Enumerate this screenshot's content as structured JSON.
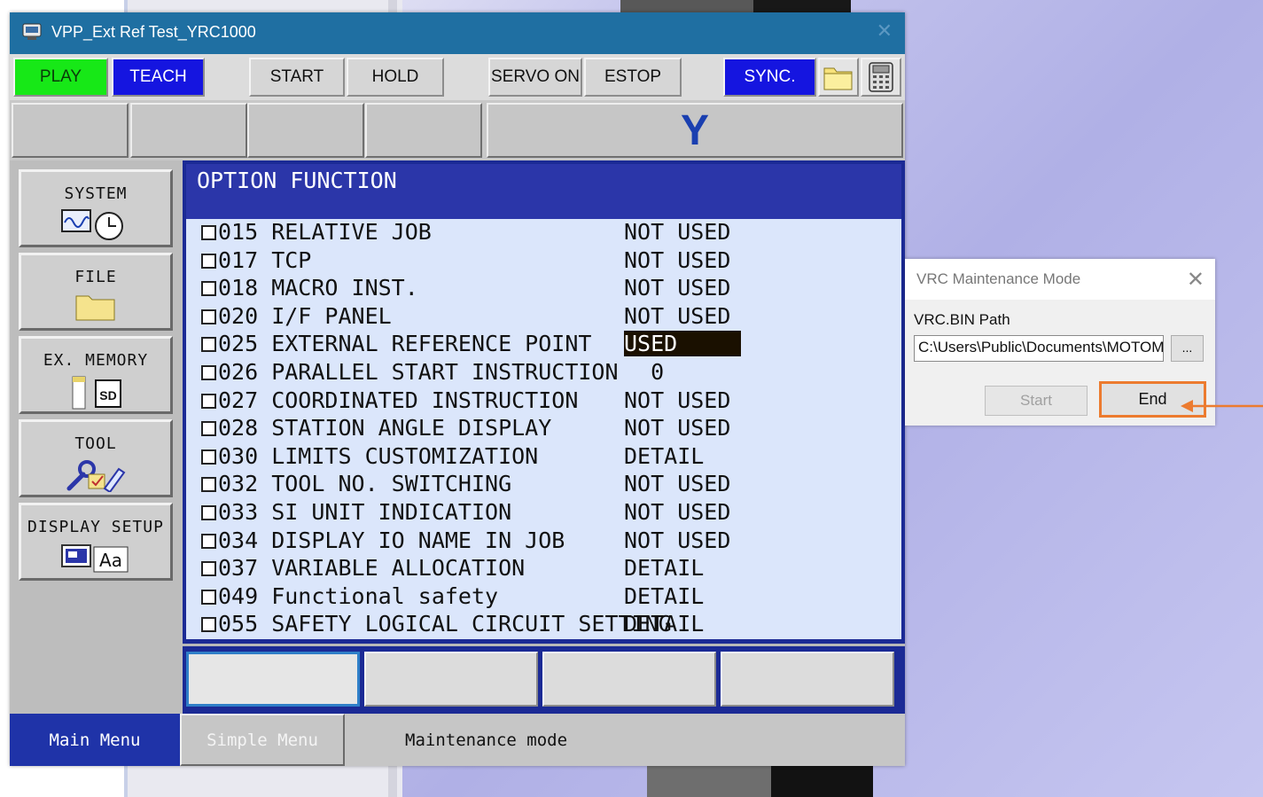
{
  "window": {
    "title": "VPP_Ext Ref Test_YRC1000",
    "close_glyph": "✕"
  },
  "toolbar": {
    "play": "PLAY",
    "teach": "TEACH",
    "start": "START",
    "hold": "HOLD",
    "servo_on": "SERVO ON",
    "estop": "ESTOP",
    "sync": "SYNC.",
    "folder_icon": "folder-icon",
    "pendant_icon": "teach-pendant-icon"
  },
  "logo": "Y",
  "sidebar": {
    "items": [
      {
        "label": "SYSTEM",
        "icon": "system-icon"
      },
      {
        "label": "FILE",
        "icon": "folder-icon"
      },
      {
        "label": "EX. MEMORY",
        "icon": "sd-card-icon"
      },
      {
        "label": "TOOL",
        "icon": "tool-icon"
      },
      {
        "label": "DISPLAY SETUP",
        "icon": "display-setup-icon"
      }
    ]
  },
  "panel": {
    "title": "OPTION FUNCTION",
    "rows": [
      {
        "name": "015 RELATIVE JOB",
        "value": "NOT USED"
      },
      {
        "name": "017 TCP",
        "value": "NOT USED"
      },
      {
        "name": "018 MACRO INST.",
        "value": "NOT USED"
      },
      {
        "name": "020 I/F PANEL",
        "value": "NOT USED"
      },
      {
        "name": "025 EXTERNAL REFERENCE POINT",
        "value": "USED",
        "highlight": true
      },
      {
        "name": "026 PARALLEL START INSTRUCTION",
        "value": "  0"
      },
      {
        "name": "027 COORDINATED INSTRUCTION",
        "value": "NOT USED"
      },
      {
        "name": "028 STATION ANGLE DISPLAY",
        "value": "NOT USED"
      },
      {
        "name": "030 LIMITS CUSTOMIZATION",
        "value": "DETAIL"
      },
      {
        "name": "032 TOOL NO. SWITCHING",
        "value": "NOT USED"
      },
      {
        "name": "033 SI UNIT INDICATION",
        "value": "NOT USED"
      },
      {
        "name": "034 DISPLAY IO NAME IN JOB",
        "value": "NOT USED"
      },
      {
        "name": "037 VARIABLE ALLOCATION",
        "value": "DETAIL"
      },
      {
        "name": "049 Functional safety",
        "value": "DETAIL"
      },
      {
        "name": "055 SAFETY LOGICAL CIRCUIT SETTING",
        "value": "DETAIL"
      }
    ]
  },
  "bottom": {
    "main_menu": "Main Menu",
    "simple_menu": "Simple Menu",
    "status": "Maintenance mode"
  },
  "dialog": {
    "title": "VRC Maintenance Mode",
    "path_label": "VRC.BIN Path",
    "path_value": "C:\\Users\\Public\\Documents\\MOTOMAN",
    "browse": "...",
    "start": "Start",
    "end": "End",
    "close_glyph": "✕"
  },
  "colors": {
    "title_bar": "#1f6fa2",
    "play": "#17e817",
    "blue_button": "#1515e0",
    "panel_header": "#2b36a9",
    "list_bg": "#dbe6fb",
    "highlight_arrow": "#ec7b2f"
  }
}
